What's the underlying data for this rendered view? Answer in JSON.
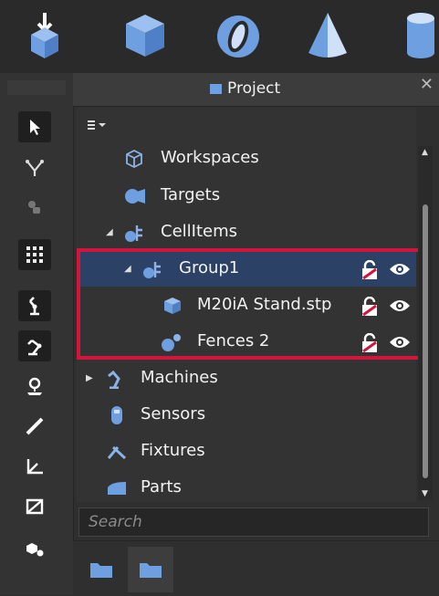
{
  "toolbar": {
    "icons": [
      "import-box-icon",
      "cube-icon",
      "sphere-icon",
      "cone-icon",
      "cylinder-icon"
    ]
  },
  "left_toolbar": {
    "icons": [
      "select-arrow-icon",
      "tree-nodes-icon",
      "robot-hand-icon",
      "grid-icon",
      "robot-arm-icon",
      "robot-arm-alt-icon",
      "location-pin-icon",
      "measure-ruler-icon",
      "axes-icon",
      "mirror-icon",
      "objects-icon"
    ]
  },
  "panel": {
    "title": "Project",
    "close_label": "✕"
  },
  "tree": {
    "items": [
      {
        "label": "Workspaces",
        "icon": "cube-outline-icon"
      },
      {
        "label": "Targets",
        "icon": "target-camera-icon"
      },
      {
        "label": "CellItems",
        "icon": "cellitems-icon",
        "expanded": true
      },
      {
        "label": "Group1",
        "icon": "group-icon",
        "expanded": true,
        "selected": true
      },
      {
        "label": "M20iA Stand.stp",
        "icon": "part-cube-icon"
      },
      {
        "label": "Fences 2",
        "icon": "fence-icon"
      },
      {
        "label": "Machines",
        "icon": "machine-arm-icon",
        "expanded": false
      },
      {
        "label": "Sensors",
        "icon": "sensor-icon"
      },
      {
        "label": "Fixtures",
        "icon": "fixture-icon"
      },
      {
        "label": "Parts",
        "icon": "parts-icon"
      }
    ]
  },
  "search": {
    "placeholder": "Search",
    "value": ""
  },
  "colors": {
    "accent_blue": "#6e9fe0",
    "highlight_red": "#d4143a",
    "selection": "#2b4266"
  },
  "bottom_tabs": [
    "folder-icon",
    "folder-icon"
  ]
}
